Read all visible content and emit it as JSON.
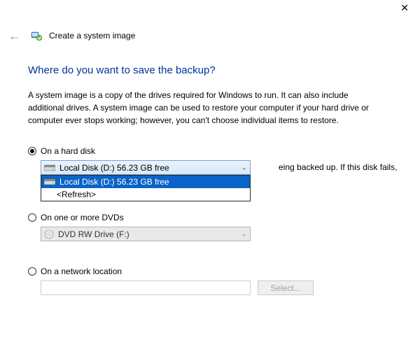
{
  "window": {
    "title": "Create a system image"
  },
  "heading": "Where do you want to save the backup?",
  "description": "A system image is a copy of the drives required for Windows to run. It can also include additional drives. A system image can be used to restore your computer if your hard drive or computer ever stops working; however, you can't choose individual items to restore.",
  "options": {
    "hard_disk": {
      "label": "On a hard disk",
      "selected_text": "Local Disk (D:)  56.23 GB free",
      "list_item_text": "Local Disk (D:)  56.23 GB free",
      "refresh_text": "<Refresh>",
      "warning_tail": "eing backed up. If this disk fails,"
    },
    "dvd": {
      "label": "On one or more DVDs",
      "selected_text": "DVD RW Drive (F:)"
    },
    "network": {
      "label": "On a network location",
      "select_button": "Select..."
    }
  }
}
